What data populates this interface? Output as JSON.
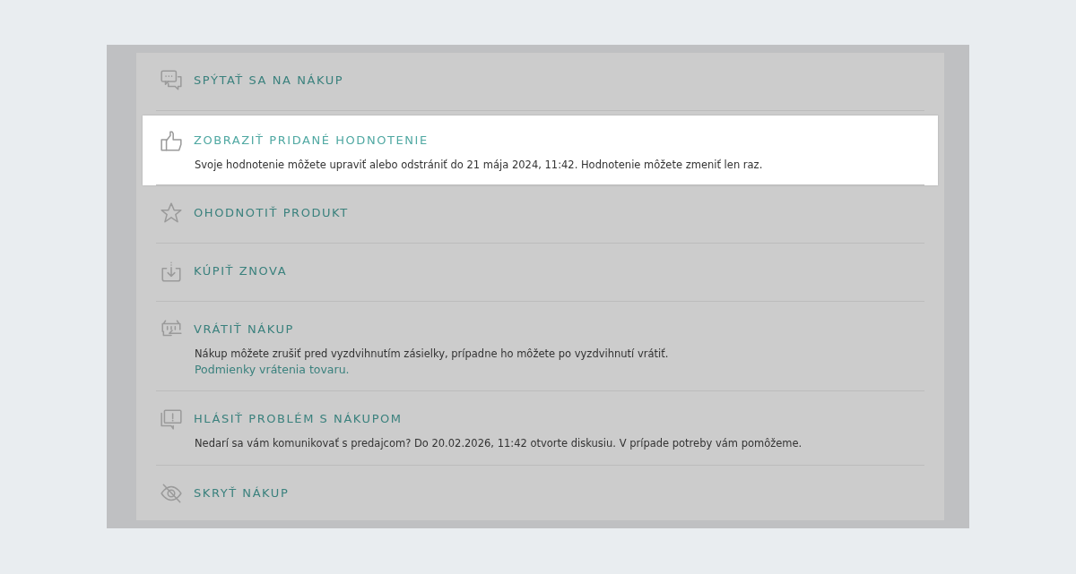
{
  "actions": [
    {
      "kind": "chat",
      "title": "SPÝTAŤ SA NA NÁKUP",
      "selected": false
    },
    {
      "kind": "thumb",
      "title": "ZOBRAZIŤ PRIDANÉ HODNOTENIE",
      "selected": true,
      "description": "Svoje hodnotenie môžete upraviť alebo odstrániť do 21 mája 2024, 11:42. Hodnotenie môžete zmeniť len raz."
    },
    {
      "kind": "star",
      "title": "OHODNOTIŤ PRODUKT",
      "selected": false
    },
    {
      "kind": "basket",
      "title": "KÚPIŤ ZNOVA",
      "selected": false
    },
    {
      "kind": "return",
      "title": "VRÁTIŤ NÁKUP",
      "selected": false,
      "description": "Nákup môžete zrušiť pred vyzdvihnutím zásielky, prípadne ho môžete po vyzdvihnutí vrátiť.",
      "link": "Podmienky vrátenia tovaru."
    },
    {
      "kind": "report",
      "title": "HLÁSIŤ PROBLÉM S NÁKUPOM",
      "selected": false,
      "description": "Nedarí sa vám komunikovať s predajcom? Do 20.02.2026, 11:42 otvorte diskusiu. V prípade potreby vám pomôžeme."
    },
    {
      "kind": "eyeoff",
      "title": "SKRYŤ NÁKUP",
      "selected": false
    }
  ]
}
